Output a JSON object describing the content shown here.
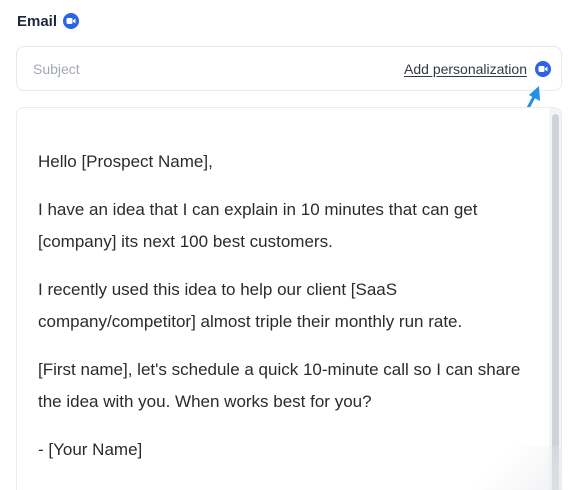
{
  "section": {
    "title": "Email",
    "icon": "video-icon"
  },
  "subject": {
    "value": "",
    "placeholder": "Subject"
  },
  "personalization": {
    "label": "Add personalization",
    "icon": "video-icon"
  },
  "body": {
    "paragraphs": [
      "Hello [Prospect Name],",
      "I have an idea that I can explain in 10 minutes that can get [company] its next 100 best customers.",
      "I recently used this idea to help our client [SaaS company/competitor] almost triple their monthly run rate.",
      "[First name], let's schedule a quick 10-minute call so I can share the idea with you. When works best for you?",
      "- [Your Name]"
    ]
  },
  "colors": {
    "accent": "#2d63e8",
    "arrow": "#1e90e6"
  }
}
